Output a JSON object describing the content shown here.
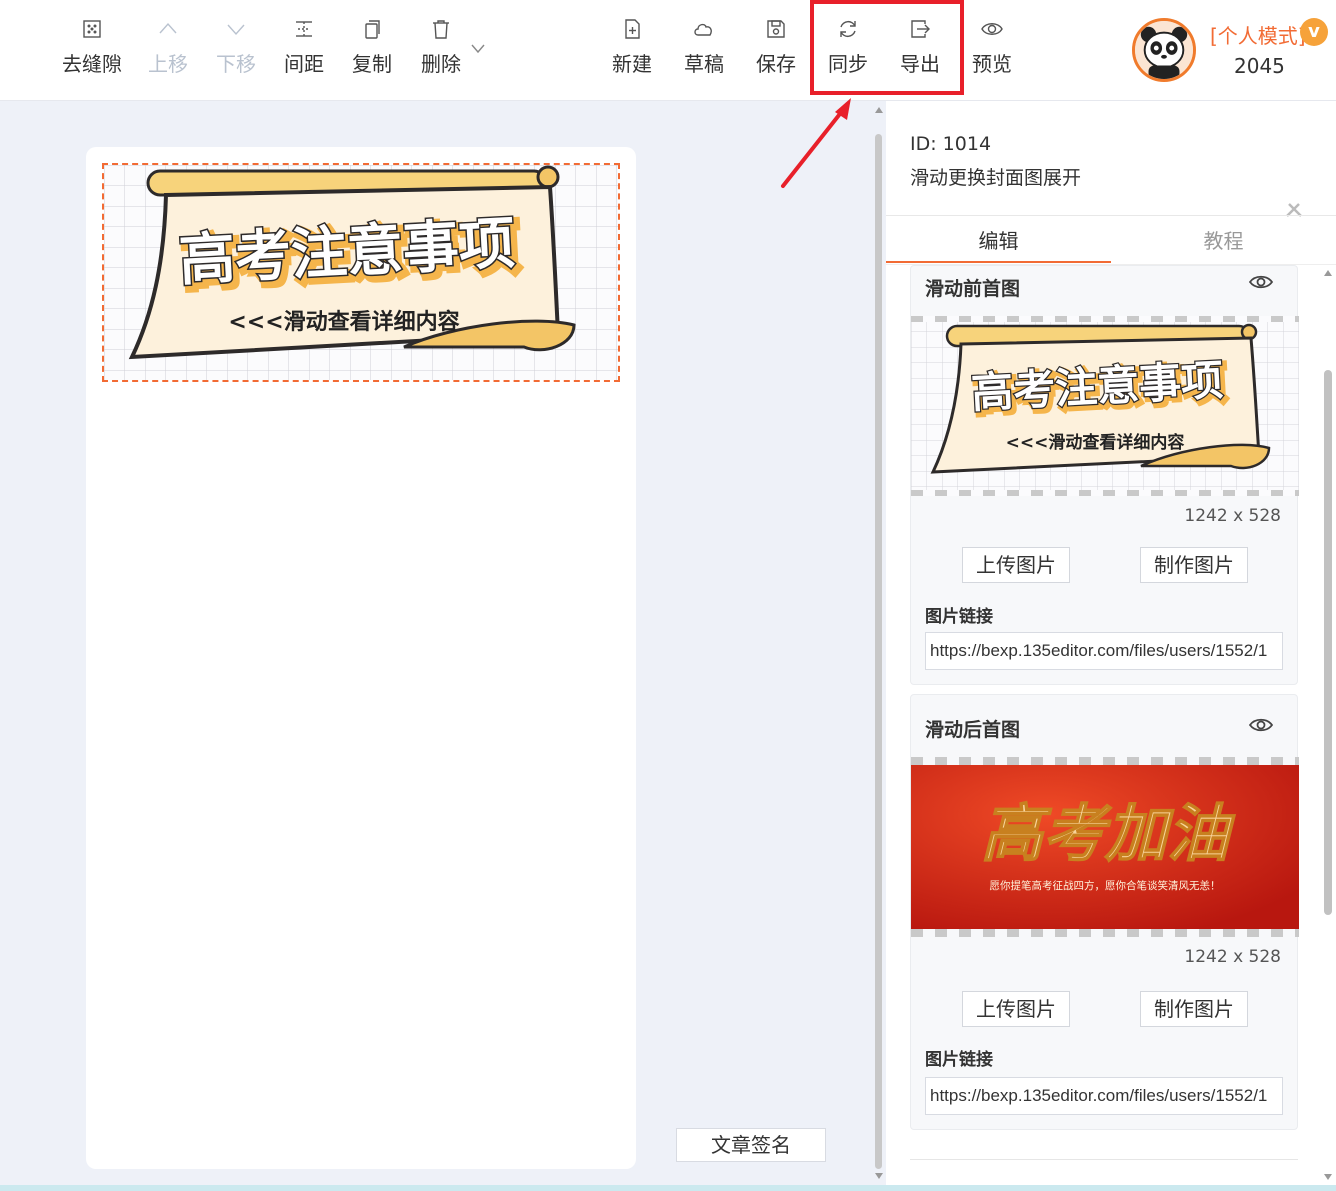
{
  "toolbar": {
    "left_buttons": [
      {
        "label": "去缝隙",
        "icon": "grid-dots-icon",
        "enabled": true
      },
      {
        "label": "上移",
        "icon": "chevron-up-icon",
        "enabled": false
      },
      {
        "label": "下移",
        "icon": "chevron-down-icon",
        "enabled": false
      },
      {
        "label": "间距",
        "icon": "spacing-icon",
        "enabled": true
      },
      {
        "label": "复制",
        "icon": "copy-icon",
        "enabled": true
      },
      {
        "label": "删除",
        "icon": "trash-icon",
        "enabled": true
      }
    ],
    "right_buttons": [
      {
        "label": "新建",
        "icon": "new-file-icon"
      },
      {
        "label": "草稿",
        "icon": "cloud-icon"
      },
      {
        "label": "保存",
        "icon": "save-icon"
      },
      {
        "label": "同步",
        "icon": "sync-icon"
      },
      {
        "label": "导出",
        "icon": "export-icon"
      },
      {
        "label": "预览",
        "icon": "eye-icon"
      }
    ]
  },
  "user": {
    "mode_label": "[个人模式]",
    "vip_badge": "v",
    "score": "2045"
  },
  "banner_before": {
    "title": "高考注意事项",
    "subtitle": "<<<滑动查看详细内容"
  },
  "banner_after": {
    "title": "高考加油",
    "subtitle": "愿你提笔高考征战四方，愿你合笔谈笑清风无恙！"
  },
  "canvas": {
    "signature_button": "文章签名"
  },
  "panel": {
    "id_text": "ID: 1014",
    "description": "滑动更换封面图展开",
    "tabs": [
      {
        "label": "编辑",
        "active": true
      },
      {
        "label": "教程",
        "active": false
      }
    ],
    "cards": [
      {
        "title": "滑动前首图",
        "dims": "1242 x 528",
        "upload_label": "上传图片",
        "make_label": "制作图片",
        "link_label": "图片链接",
        "link_value": "https://bexp.135editor.com/files/users/1552/1"
      },
      {
        "title": "滑动后首图",
        "dims": "1242 x 528",
        "upload_label": "上传图片",
        "make_label": "制作图片",
        "link_label": "图片链接",
        "link_value": "https://bexp.135editor.com/files/users/1552/1"
      }
    ]
  },
  "colors": {
    "accent": "#f26b34",
    "highlight": "#e8202a",
    "banner_after_bg": "#d42a16"
  }
}
